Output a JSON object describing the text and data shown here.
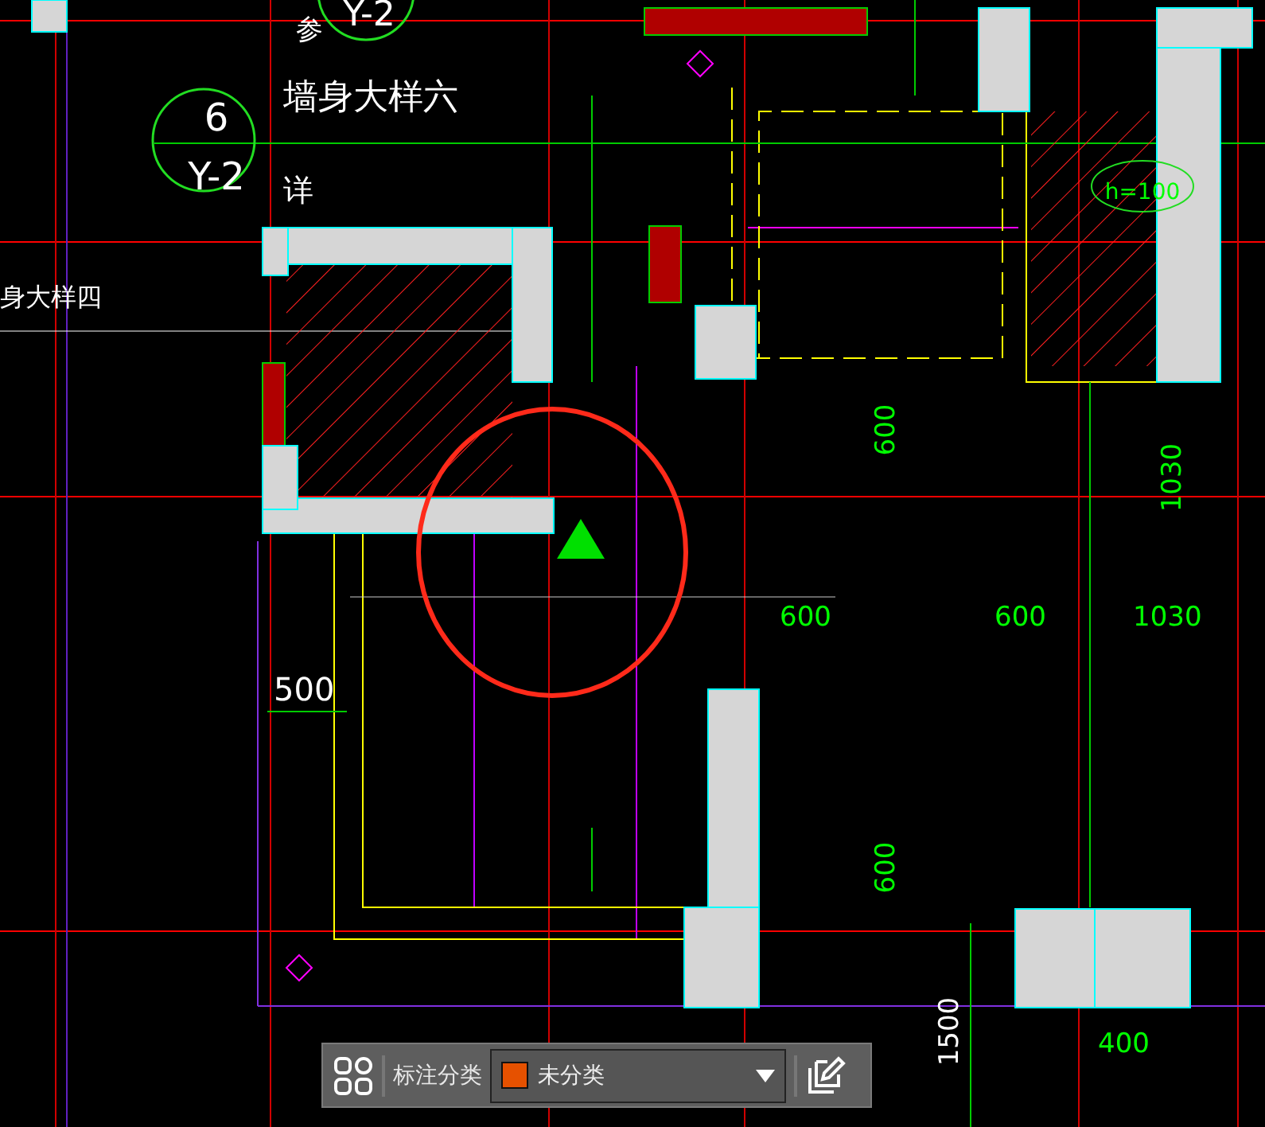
{
  "drawing": {
    "annotations": [
      {
        "text": "参",
        "color": "#ffffff"
      },
      {
        "text": "Y-2",
        "color": "#ffffff"
      },
      {
        "text": "墙身大样六",
        "color": "#ffffff"
      },
      {
        "text": "6",
        "color": "#ffffff"
      },
      {
        "text": "Y-2",
        "color": "#ffffff"
      },
      {
        "text": "详",
        "color": "#ffffff"
      },
      {
        "text": "身大样四",
        "color": "#ffffff"
      },
      {
        "text": "500",
        "color": "#ffffff"
      },
      {
        "text": "600",
        "color": "#00ff00"
      },
      {
        "text": "1030",
        "color": "#00ff00"
      },
      {
        "text": "600",
        "color": "#00ff00"
      },
      {
        "text": "600",
        "color": "#00ff00"
      },
      {
        "text": "1030",
        "color": "#00ff00"
      },
      {
        "text": "h=100",
        "color": "#00ff00"
      },
      {
        "text": "600",
        "color": "#00ff00"
      },
      {
        "text": "1500",
        "color": "#ffffff"
      },
      {
        "text": "400",
        "color": "#00ff00"
      }
    ]
  },
  "toolbar": {
    "label": "标注分类",
    "category": {
      "value": "未分类",
      "color": "#e65100"
    }
  }
}
